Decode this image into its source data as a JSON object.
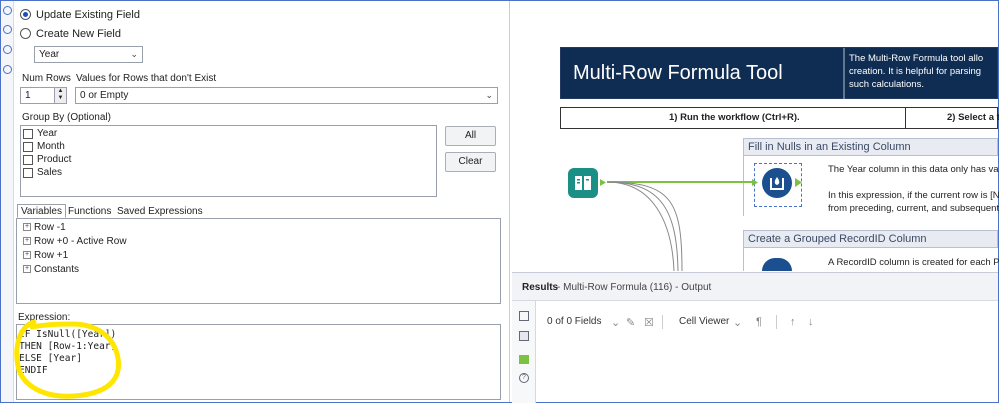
{
  "config": {
    "radio_update": "Update Existing Field",
    "radio_create": "Create New  Field",
    "field_select": "Year",
    "num_rows_label": "Num Rows",
    "num_rows_value": "1",
    "values_label": "Values for Rows that don't Exist",
    "values_select": "0 or Empty",
    "group_by_label": "Group By (Optional)",
    "group_by_items": [
      "Year",
      "Month",
      "Product",
      "Sales"
    ],
    "btn_all": "All",
    "btn_clear": "Clear",
    "tabs": [
      "Variables",
      "Functions",
      "Saved Expressions"
    ],
    "tree": [
      "Row -1",
      "Row +0 - Active Row",
      "Row +1",
      "Constants"
    ],
    "expression_label": "Expression:",
    "expression": "IF IsNull([Year])\nTHEN [Row-1:Year]\nELSE [Year]\nENDIF"
  },
  "canvas": {
    "banner_title": "Multi-Row Formula Tool",
    "banner_desc": [
      "The Multi-Row Formula tool allo",
      "creation. It is helpful for parsing",
      "such calculations."
    ],
    "step1": "1) Run the workflow (Ctrl+R).",
    "step2": "2) Select a t",
    "container1_title": "Fill in Nulls in an Existing Column",
    "container1_text1": "The Year column in this data only has val",
    "container1_text2a": "In this expression, if the current row is [N",
    "container1_text2b": "from preceding, current, and subsequent",
    "container2_title": "Create a Grouped RecordID Column",
    "container2_text": "A RecordID column is created for each P"
  },
  "results": {
    "title": "Results",
    "subtitle": " - Multi-Row Formula (116) - Output",
    "fields": "0 of 0 Fields",
    "cell_viewer": "Cell Viewer"
  },
  "colors": {
    "banner_bg": "#0f2d52",
    "highlight": "#ffe600",
    "tool_teal": "#1a8f86",
    "tool_blue": "#1b4f8f",
    "connector_green": "#7cc242"
  }
}
